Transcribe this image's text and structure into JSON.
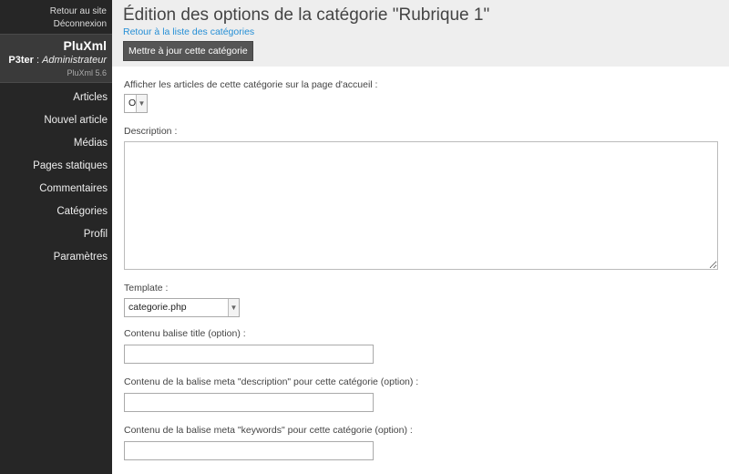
{
  "sidebar": {
    "top_links": {
      "site": "Retour au site",
      "logout": "Déconnexion"
    },
    "brand": "PluXml",
    "user_name": "P3ter",
    "user_separator": " : ",
    "user_role": "Administrateur",
    "version": "PluXml 5.6",
    "nav": [
      {
        "label": "Articles"
      },
      {
        "label": "Nouvel article"
      },
      {
        "label": "Médias"
      },
      {
        "label": "Pages statiques"
      },
      {
        "label": "Commentaires"
      },
      {
        "label": "Catégories"
      },
      {
        "label": "Profil"
      },
      {
        "label": "Paramètres"
      }
    ]
  },
  "header": {
    "title": "Édition des options de la catégorie \"Rubrique 1\"",
    "back_link": "Retour à la liste des catégories",
    "update_button": "Mettre à jour cette catégorie"
  },
  "form": {
    "homepage_label": "Afficher les articles de cette catégorie sur la page d'accueil :",
    "homepage_value": "Oui",
    "description_label": "Description :",
    "description_value": "",
    "template_label": "Template :",
    "template_value": "categorie.php",
    "title_tag_label": "Contenu balise title (option) :",
    "title_tag_value": "",
    "meta_description_label": "Contenu de la balise meta \"description\" pour cette catégorie (option) :",
    "meta_description_value": "",
    "meta_keywords_label": "Contenu de la balise meta \"keywords\" pour cette catégorie (option) :",
    "meta_keywords_value": ""
  },
  "icons": {
    "dropdown": "chevron-down-icon",
    "resize": "resize-handle-icon"
  }
}
